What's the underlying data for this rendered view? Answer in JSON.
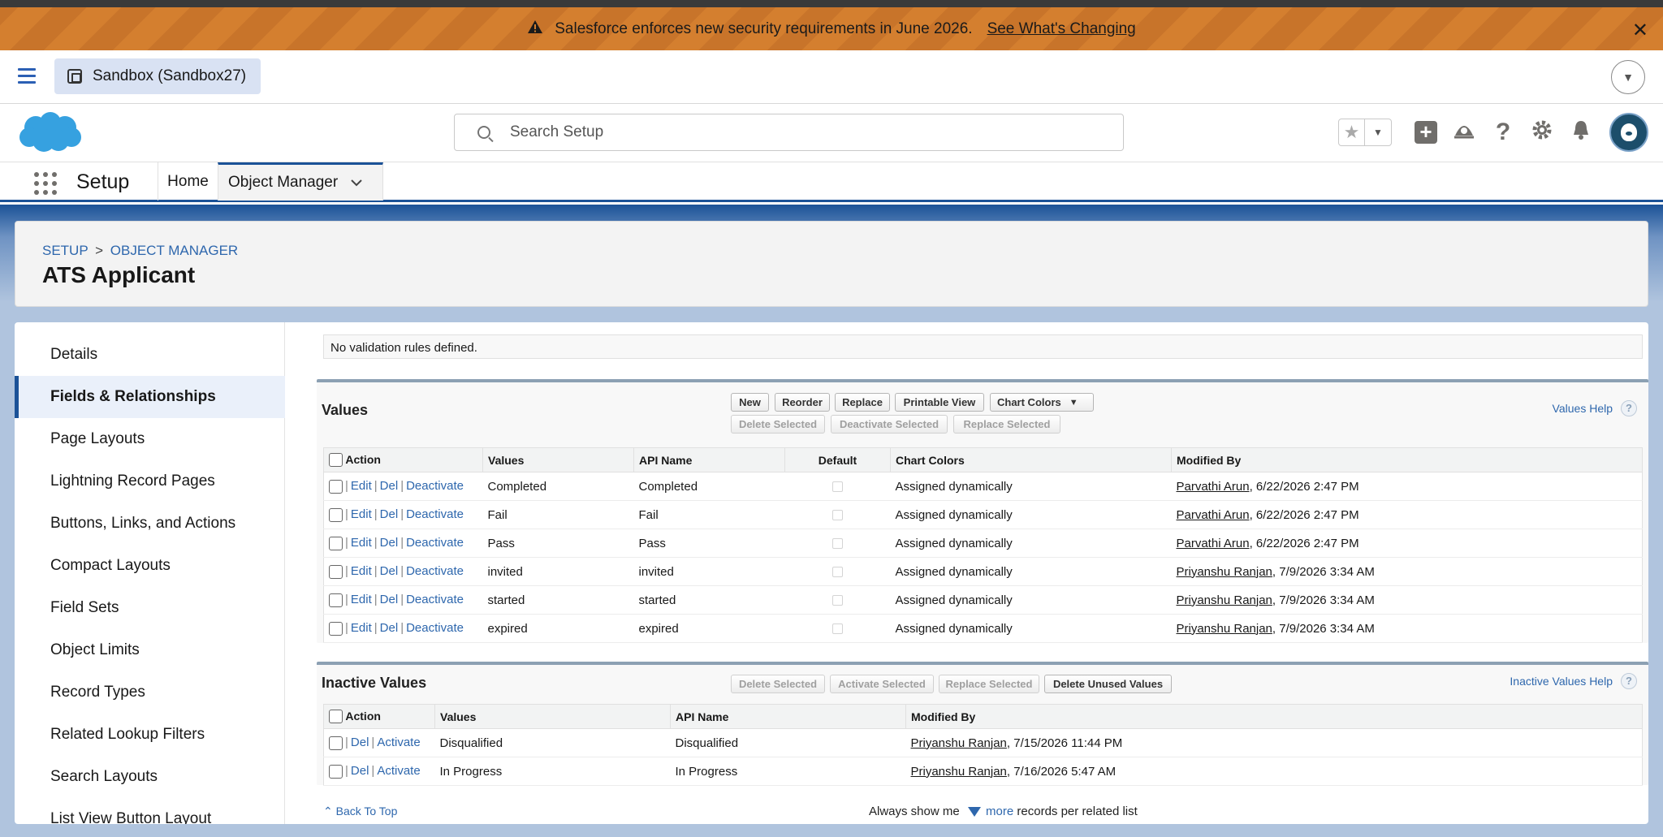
{
  "banner": {
    "message": "Salesforce enforces new security requirements in June 2026.",
    "link": "See What's Changing"
  },
  "sandbox": {
    "label": "Sandbox (Sandbox27)"
  },
  "search": {
    "placeholder": "Search Setup"
  },
  "nav": {
    "app_title": "Setup",
    "tabs": [
      "Home",
      "Object Manager"
    ]
  },
  "breadcrumb": {
    "root": "SETUP",
    "separator": ">",
    "current": "OBJECT MANAGER"
  },
  "object_title": "ATS Applicant",
  "sidebar": {
    "items": [
      "Details",
      "Fields & Relationships",
      "Page Layouts",
      "Lightning Record Pages",
      "Buttons, Links, and Actions",
      "Compact Layouts",
      "Field Sets",
      "Object Limits",
      "Record Types",
      "Related Lookup Filters",
      "Search Layouts",
      "List View Button Layout"
    ],
    "active_index": 1
  },
  "validation": {
    "text": "No validation rules defined."
  },
  "values_section": {
    "title": "Values",
    "buttons": [
      "New",
      "Reorder",
      "Replace",
      "Printable View",
      "Chart Colors"
    ],
    "disabled_buttons": [
      "Delete Selected",
      "Deactivate Selected",
      "Replace Selected"
    ],
    "help": "Values Help",
    "columns": [
      "Action",
      "Values",
      "API Name",
      "Default",
      "Chart Colors",
      "Modified By"
    ],
    "actions": [
      "Edit",
      "Del",
      "Deactivate"
    ],
    "rows": [
      {
        "value": "Completed",
        "api": "Completed",
        "color": "Assigned dynamically",
        "user": "Parvathi Arun",
        "date": ", 6/22/2026 2:47 PM"
      },
      {
        "value": "Fail",
        "api": "Fail",
        "color": "Assigned dynamically",
        "user": "Parvathi Arun",
        "date": ", 6/22/2026 2:47 PM"
      },
      {
        "value": "Pass",
        "api": "Pass",
        "color": "Assigned dynamically",
        "user": "Parvathi Arun",
        "date": ", 6/22/2026 2:47 PM"
      },
      {
        "value": "invited",
        "api": "invited",
        "color": "Assigned dynamically",
        "user": "Priyanshu Ranjan",
        "date": ", 7/9/2026 3:34 AM"
      },
      {
        "value": "started",
        "api": "started",
        "color": "Assigned dynamically",
        "user": "Priyanshu Ranjan",
        "date": ", 7/9/2026 3:34 AM"
      },
      {
        "value": "expired",
        "api": "expired",
        "color": "Assigned dynamically",
        "user": "Priyanshu Ranjan",
        "date": ", 7/9/2026 3:34 AM"
      }
    ]
  },
  "inactive_section": {
    "title": "Inactive Values",
    "disabled_buttons": [
      "Delete Selected",
      "Activate Selected",
      "Replace Selected"
    ],
    "buttons": [
      "Delete Unused Values"
    ],
    "help": "Inactive Values Help",
    "columns": [
      "Action",
      "Values",
      "API Name",
      "Modified By"
    ],
    "actions": [
      "Del",
      "Activate"
    ],
    "rows": [
      {
        "value": "Disqualified",
        "api": "Disqualified",
        "user": "Priyanshu Ranjan",
        "date": ", 7/15/2026 11:44 PM"
      },
      {
        "value": "In Progress",
        "api": "In Progress",
        "user": "Priyanshu Ranjan",
        "date": ", 7/16/2026 5:47 AM"
      }
    ]
  },
  "footer": {
    "back_to_top": "Back To Top",
    "always_show": "Always show me",
    "more": "more",
    "records_suffix": "records per related list"
  },
  "icons": [
    "warning-icon",
    "close-icon",
    "hamburger-icon",
    "sandbox-icon",
    "search-icon",
    "star-icon",
    "plus-icon",
    "trailhead-icon",
    "help-icon",
    "gear-icon",
    "bell-icon",
    "waffle-icon",
    "chevron-down-icon"
  ],
  "colors": {
    "banner": "#d47f2f",
    "link": "#2e67ad",
    "brand_blue": "#1b5297",
    "salesforce_cloud": "#36a1e0"
  }
}
